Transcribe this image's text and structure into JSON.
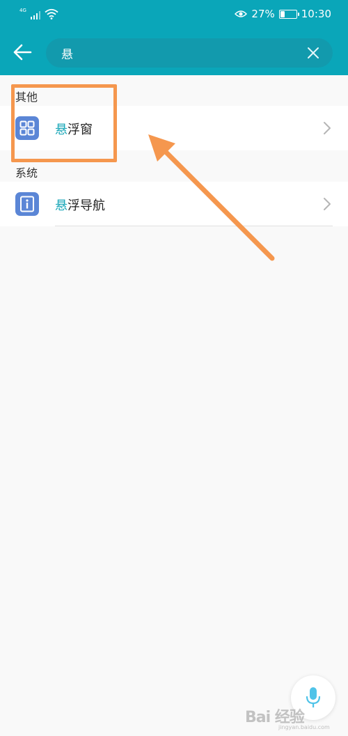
{
  "status_bar": {
    "network": "4G",
    "battery": "27%",
    "battery_level": 0.27,
    "time": "10:30"
  },
  "search": {
    "query": "悬",
    "placeholder": ""
  },
  "sections": [
    {
      "header": "其他",
      "items": [
        {
          "highlight": "悬",
          "rest": "浮窗",
          "icon": "grid-icon"
        }
      ]
    },
    {
      "header": "系统",
      "items": [
        {
          "highlight": "悬",
          "rest": "浮导航",
          "icon": "info-icon"
        }
      ]
    }
  ],
  "colors": {
    "app_bar": "#0aa6b9",
    "highlight": "#1aa7b8",
    "annotation": "#f5974e",
    "icon_bg": "#5b86d6"
  },
  "watermark": {
    "text": "Bai 经验",
    "sub": "jingyan.baidu.com"
  }
}
